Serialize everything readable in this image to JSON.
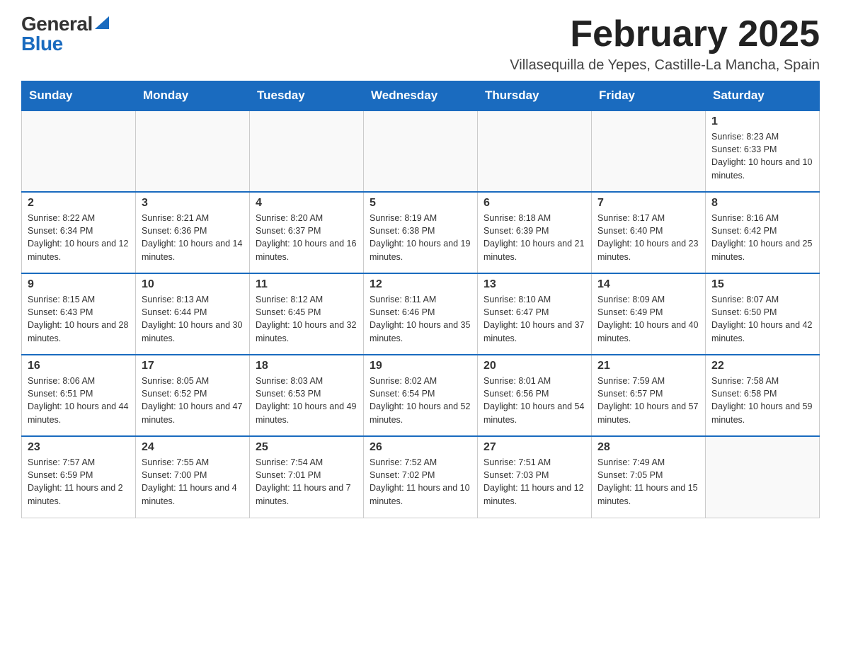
{
  "header": {
    "logo_general": "General",
    "logo_blue": "Blue",
    "month_title": "February 2025",
    "location": "Villasequilla de Yepes, Castille-La Mancha, Spain"
  },
  "weekdays": [
    "Sunday",
    "Monday",
    "Tuesday",
    "Wednesday",
    "Thursday",
    "Friday",
    "Saturday"
  ],
  "weeks": [
    [
      {
        "day": "",
        "sunrise": "",
        "sunset": "",
        "daylight": ""
      },
      {
        "day": "",
        "sunrise": "",
        "sunset": "",
        "daylight": ""
      },
      {
        "day": "",
        "sunrise": "",
        "sunset": "",
        "daylight": ""
      },
      {
        "day": "",
        "sunrise": "",
        "sunset": "",
        "daylight": ""
      },
      {
        "day": "",
        "sunrise": "",
        "sunset": "",
        "daylight": ""
      },
      {
        "day": "",
        "sunrise": "",
        "sunset": "",
        "daylight": ""
      },
      {
        "day": "1",
        "sunrise": "Sunrise: 8:23 AM",
        "sunset": "Sunset: 6:33 PM",
        "daylight": "Daylight: 10 hours and 10 minutes."
      }
    ],
    [
      {
        "day": "2",
        "sunrise": "Sunrise: 8:22 AM",
        "sunset": "Sunset: 6:34 PM",
        "daylight": "Daylight: 10 hours and 12 minutes."
      },
      {
        "day": "3",
        "sunrise": "Sunrise: 8:21 AM",
        "sunset": "Sunset: 6:36 PM",
        "daylight": "Daylight: 10 hours and 14 minutes."
      },
      {
        "day": "4",
        "sunrise": "Sunrise: 8:20 AM",
        "sunset": "Sunset: 6:37 PM",
        "daylight": "Daylight: 10 hours and 16 minutes."
      },
      {
        "day": "5",
        "sunrise": "Sunrise: 8:19 AM",
        "sunset": "Sunset: 6:38 PM",
        "daylight": "Daylight: 10 hours and 19 minutes."
      },
      {
        "day": "6",
        "sunrise": "Sunrise: 8:18 AM",
        "sunset": "Sunset: 6:39 PM",
        "daylight": "Daylight: 10 hours and 21 minutes."
      },
      {
        "day": "7",
        "sunrise": "Sunrise: 8:17 AM",
        "sunset": "Sunset: 6:40 PM",
        "daylight": "Daylight: 10 hours and 23 minutes."
      },
      {
        "day": "8",
        "sunrise": "Sunrise: 8:16 AM",
        "sunset": "Sunset: 6:42 PM",
        "daylight": "Daylight: 10 hours and 25 minutes."
      }
    ],
    [
      {
        "day": "9",
        "sunrise": "Sunrise: 8:15 AM",
        "sunset": "Sunset: 6:43 PM",
        "daylight": "Daylight: 10 hours and 28 minutes."
      },
      {
        "day": "10",
        "sunrise": "Sunrise: 8:13 AM",
        "sunset": "Sunset: 6:44 PM",
        "daylight": "Daylight: 10 hours and 30 minutes."
      },
      {
        "day": "11",
        "sunrise": "Sunrise: 8:12 AM",
        "sunset": "Sunset: 6:45 PM",
        "daylight": "Daylight: 10 hours and 32 minutes."
      },
      {
        "day": "12",
        "sunrise": "Sunrise: 8:11 AM",
        "sunset": "Sunset: 6:46 PM",
        "daylight": "Daylight: 10 hours and 35 minutes."
      },
      {
        "day": "13",
        "sunrise": "Sunrise: 8:10 AM",
        "sunset": "Sunset: 6:47 PM",
        "daylight": "Daylight: 10 hours and 37 minutes."
      },
      {
        "day": "14",
        "sunrise": "Sunrise: 8:09 AM",
        "sunset": "Sunset: 6:49 PM",
        "daylight": "Daylight: 10 hours and 40 minutes."
      },
      {
        "day": "15",
        "sunrise": "Sunrise: 8:07 AM",
        "sunset": "Sunset: 6:50 PM",
        "daylight": "Daylight: 10 hours and 42 minutes."
      }
    ],
    [
      {
        "day": "16",
        "sunrise": "Sunrise: 8:06 AM",
        "sunset": "Sunset: 6:51 PM",
        "daylight": "Daylight: 10 hours and 44 minutes."
      },
      {
        "day": "17",
        "sunrise": "Sunrise: 8:05 AM",
        "sunset": "Sunset: 6:52 PM",
        "daylight": "Daylight: 10 hours and 47 minutes."
      },
      {
        "day": "18",
        "sunrise": "Sunrise: 8:03 AM",
        "sunset": "Sunset: 6:53 PM",
        "daylight": "Daylight: 10 hours and 49 minutes."
      },
      {
        "day": "19",
        "sunrise": "Sunrise: 8:02 AM",
        "sunset": "Sunset: 6:54 PM",
        "daylight": "Daylight: 10 hours and 52 minutes."
      },
      {
        "day": "20",
        "sunrise": "Sunrise: 8:01 AM",
        "sunset": "Sunset: 6:56 PM",
        "daylight": "Daylight: 10 hours and 54 minutes."
      },
      {
        "day": "21",
        "sunrise": "Sunrise: 7:59 AM",
        "sunset": "Sunset: 6:57 PM",
        "daylight": "Daylight: 10 hours and 57 minutes."
      },
      {
        "day": "22",
        "sunrise": "Sunrise: 7:58 AM",
        "sunset": "Sunset: 6:58 PM",
        "daylight": "Daylight: 10 hours and 59 minutes."
      }
    ],
    [
      {
        "day": "23",
        "sunrise": "Sunrise: 7:57 AM",
        "sunset": "Sunset: 6:59 PM",
        "daylight": "Daylight: 11 hours and 2 minutes."
      },
      {
        "day": "24",
        "sunrise": "Sunrise: 7:55 AM",
        "sunset": "Sunset: 7:00 PM",
        "daylight": "Daylight: 11 hours and 4 minutes."
      },
      {
        "day": "25",
        "sunrise": "Sunrise: 7:54 AM",
        "sunset": "Sunset: 7:01 PM",
        "daylight": "Daylight: 11 hours and 7 minutes."
      },
      {
        "day": "26",
        "sunrise": "Sunrise: 7:52 AM",
        "sunset": "Sunset: 7:02 PM",
        "daylight": "Daylight: 11 hours and 10 minutes."
      },
      {
        "day": "27",
        "sunrise": "Sunrise: 7:51 AM",
        "sunset": "Sunset: 7:03 PM",
        "daylight": "Daylight: 11 hours and 12 minutes."
      },
      {
        "day": "28",
        "sunrise": "Sunrise: 7:49 AM",
        "sunset": "Sunset: 7:05 PM",
        "daylight": "Daylight: 11 hours and 15 minutes."
      },
      {
        "day": "",
        "sunrise": "",
        "sunset": "",
        "daylight": ""
      }
    ]
  ]
}
